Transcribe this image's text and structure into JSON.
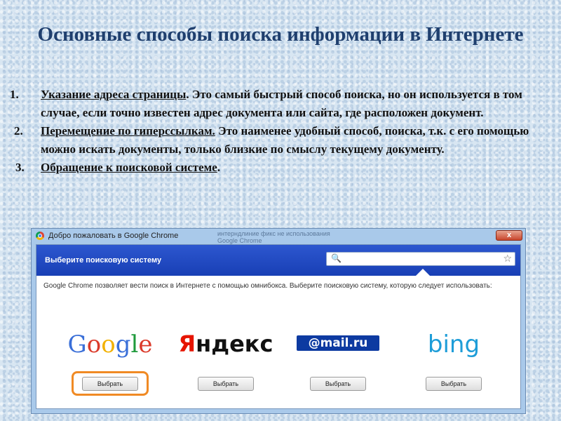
{
  "slide": {
    "title": "Основные способы поиска информации в Интернете",
    "points": [
      {
        "num": "1.",
        "lead": "Указание адреса страницы",
        "rest": ". Это самый быстрый способ поиска, но он используется в том случае, если точно известен адрес документа или сайта, где расположен документ."
      },
      {
        "num": "2.",
        "lead": "Перемещение  по гиперссылкам.",
        "rest": " Это наименее удобный способ, поиска, т.к. с его помощью можно искать документы, только близкие по смыслу текущему документу."
      },
      {
        "num": "3.",
        "lead": "Обращение к поисковой системе",
        "rest": "."
      }
    ]
  },
  "browser": {
    "window_title": "Добро пожаловать в Google Chrome",
    "bg_text_1": "интерндлиние фикс не использования",
    "bg_text_2": "Google Chrome",
    "close_label": "x",
    "header_title": "Выберите поисковую систему",
    "omnibox": {
      "search_icon": "🔍",
      "star_icon": "☆"
    },
    "description": "Google Chrome позволяет вести поиск в Интернете с помощью омнибокса. Выберите поисковую систему, которую следует использовать:",
    "engines": [
      {
        "name": "Google",
        "button": "Выбрать"
      },
      {
        "name": "Яндекс",
        "button": "Выбрать"
      },
      {
        "name": "@mail.ru",
        "button": "Выбрать"
      },
      {
        "name": "bing",
        "button": "Выбрать"
      }
    ],
    "colors": {
      "header": "#1f48c2",
      "highlight": "#f08a24",
      "bing": "#1e9dd8",
      "mail": "#0d3aa1",
      "yandex_red": "#e61400"
    }
  }
}
